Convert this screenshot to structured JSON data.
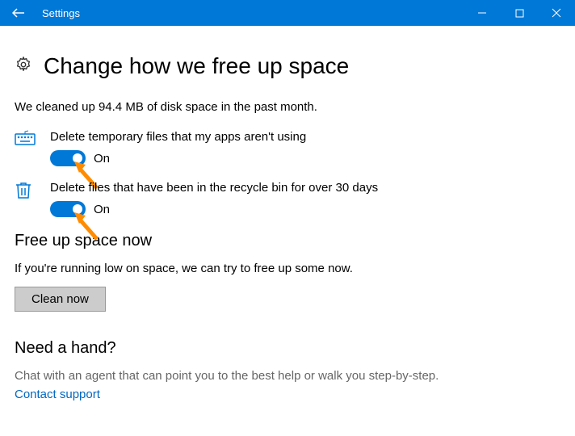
{
  "window": {
    "title": "Settings"
  },
  "page": {
    "heading": "Change how we free up space",
    "status": "We cleaned up 94.4 MB of disk space in the past month."
  },
  "options": {
    "temp": {
      "label": "Delete temporary files that my apps aren't using",
      "state": "On"
    },
    "recycle": {
      "label": "Delete files that have been in the recycle bin for over 30 days",
      "state": "On"
    }
  },
  "freeup": {
    "heading": "Free up space now",
    "text": "If you're running low on space, we can try to free up some now.",
    "button": "Clean now"
  },
  "help": {
    "heading": "Need a hand?",
    "text": "Chat with an agent that can point you to the best help or walk you step-by-step.",
    "link": "Contact support"
  }
}
